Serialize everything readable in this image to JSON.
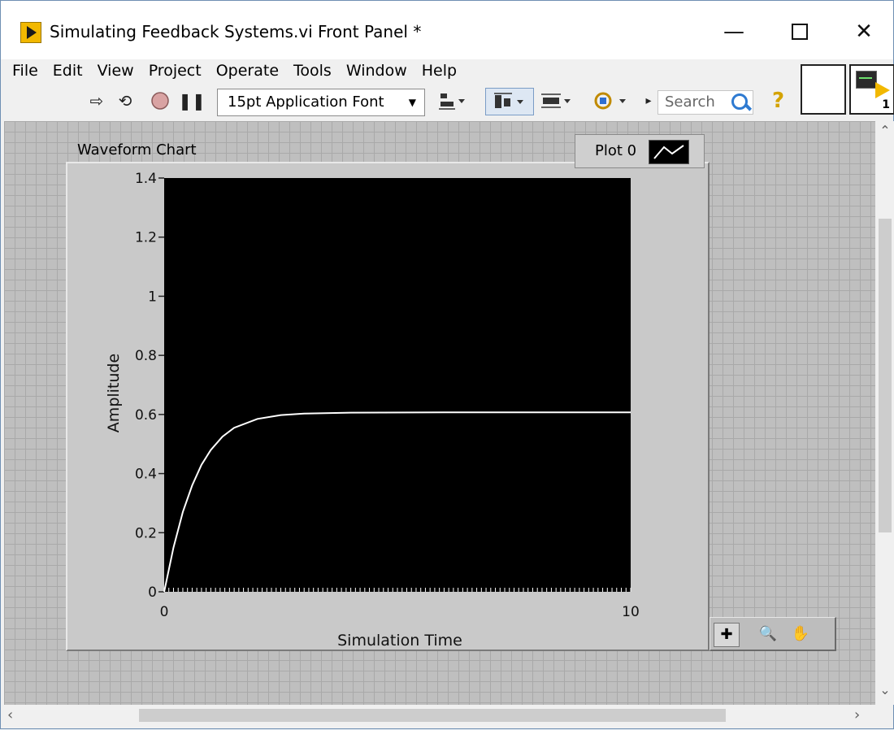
{
  "window": {
    "title": "Simulating Feedback Systems.vi Front Panel *",
    "minimize": "—",
    "close": "✕"
  },
  "menu": [
    "File",
    "Edit",
    "View",
    "Project",
    "Operate",
    "Tools",
    "Window",
    "Help"
  ],
  "toolbar": {
    "font": "15pt Application Font",
    "search_placeholder": "Search",
    "icons": [
      "run-arrow-icon",
      "run-continuous-icon",
      "abort-icon",
      "pause-icon",
      "align-icon",
      "distribute-icon",
      "resize-icon",
      "reorder-icon",
      "help-icon"
    ]
  },
  "vi_icon": {
    "terminal_number": "1"
  },
  "chart": {
    "label": "Waveform Chart",
    "legend_plot_name": "Plot 0"
  },
  "chart_data": {
    "type": "line",
    "title": "",
    "xlabel": "Simulation Time",
    "ylabel": "Amplitude",
    "xlim": [
      0,
      10
    ],
    "ylim": [
      0,
      1.4
    ],
    "x_ticks": [
      "0",
      "10"
    ],
    "y_ticks": [
      "0",
      "0.2",
      "0.4",
      "0.6",
      "0.8",
      "1",
      "1.2",
      "1.4"
    ],
    "series": [
      {
        "name": "Plot 0",
        "color": "#ffffff",
        "x": [
          0,
          0.2,
          0.4,
          0.6,
          0.8,
          1.0,
          1.25,
          1.5,
          2.0,
          2.5,
          3.0,
          4.0,
          6.0,
          8.0,
          10.0
        ],
        "y": [
          0,
          0.15,
          0.27,
          0.36,
          0.43,
          0.48,
          0.525,
          0.555,
          0.585,
          0.598,
          0.603,
          0.606,
          0.607,
          0.607,
          0.607
        ]
      }
    ],
    "plot_background": "#000000",
    "grid": false
  }
}
